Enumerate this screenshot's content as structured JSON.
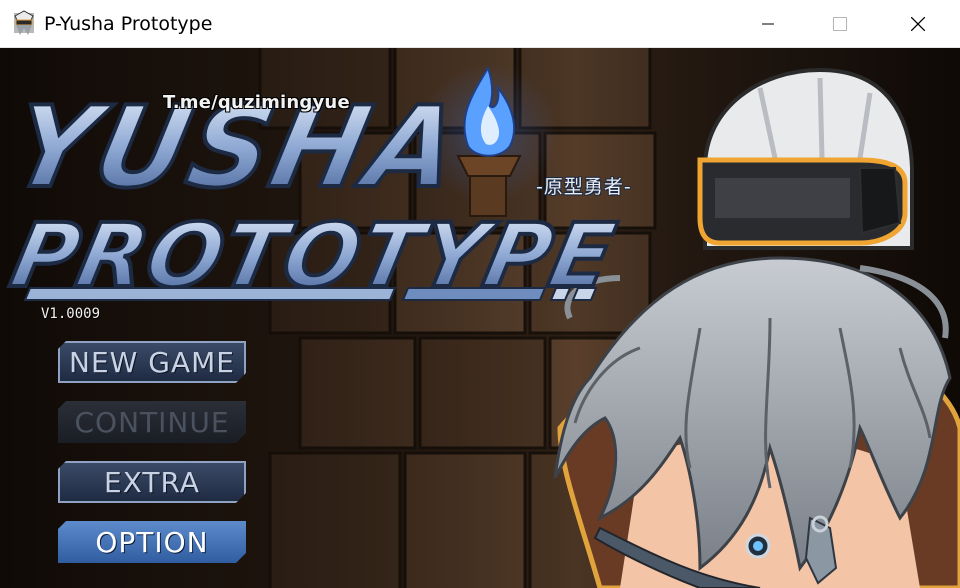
{
  "window": {
    "title": "P-Yusha Prototype",
    "controls": {
      "minimize": "minimize",
      "maximize": "maximize",
      "close": "close"
    }
  },
  "logo": {
    "line1": "YUSHA",
    "line2": "PROTOTYPE",
    "tag": "T.me/quzimingyue",
    "subtitle": "-原型勇者-",
    "version": "V1.0009"
  },
  "menu": {
    "items": [
      {
        "label": "NEW GAME",
        "state": "enabled"
      },
      {
        "label": "CONTINUE",
        "state": "disabled"
      },
      {
        "label": "EXTRA",
        "state": "enabled"
      },
      {
        "label": "OPTION",
        "state": "selected"
      }
    ]
  },
  "icons": {
    "app": "game-character-icon",
    "minimize": "minimize-icon",
    "maximize": "maximize-icon",
    "close": "close-icon",
    "torch": "blue-flame-torch"
  },
  "colors": {
    "wall": "#3a2a1c",
    "brick_light": "#5c4330",
    "flame": "#5aa0ff",
    "menu_active": "#2f5da0",
    "logo_blue": "#a9c0e0"
  }
}
